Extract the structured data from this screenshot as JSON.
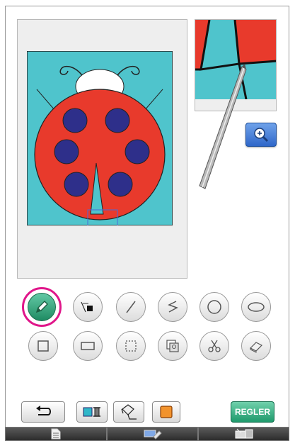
{
  "canvas": {
    "background_color": "#e9e9e9",
    "artwork_colors": {
      "teal": "#4fc4cc",
      "red": "#e83a2c",
      "navy": "#2e2f8a",
      "white": "#ffffff",
      "outline": "#222222"
    }
  },
  "preview": {
    "zoom_icon": "magnifier-plus-icon"
  },
  "tools_row1": [
    {
      "name": "pencil-tool",
      "icon": "pencil-icon",
      "selected": true
    },
    {
      "name": "line-style-tool",
      "icon": "line-fill-icon",
      "selected": false
    },
    {
      "name": "straight-line-tool",
      "icon": "line-icon",
      "selected": false
    },
    {
      "name": "zigzag-line-tool",
      "icon": "polyline-icon",
      "selected": false
    },
    {
      "name": "circle-tool",
      "icon": "circle-icon",
      "selected": false
    },
    {
      "name": "ellipse-tool",
      "icon": "ellipse-icon",
      "selected": false
    }
  ],
  "tools_row2": [
    {
      "name": "square-tool",
      "icon": "square-icon"
    },
    {
      "name": "rectangle-tool",
      "icon": "rectangle-icon"
    },
    {
      "name": "select-area-tool",
      "icon": "dotted-rectangle-icon"
    },
    {
      "name": "stamp-tool",
      "icon": "stamp-icon"
    },
    {
      "name": "cut-tool",
      "icon": "scissors-icon"
    },
    {
      "name": "eraser-tool",
      "icon": "eraser-icon"
    }
  ],
  "bottom_buttons": {
    "undo_icon": "undo-icon",
    "line_color_icon": "line-color-icon",
    "fill_icon": "paint-bucket-icon",
    "region_color_icon": "region-color-icon",
    "regler_label": "REGLER"
  },
  "tabs": [
    {
      "icon": "document-icon"
    },
    {
      "icon": "layers-icon"
    },
    {
      "icon": "machine-icon"
    }
  ],
  "accent_color": "#e0168a"
}
